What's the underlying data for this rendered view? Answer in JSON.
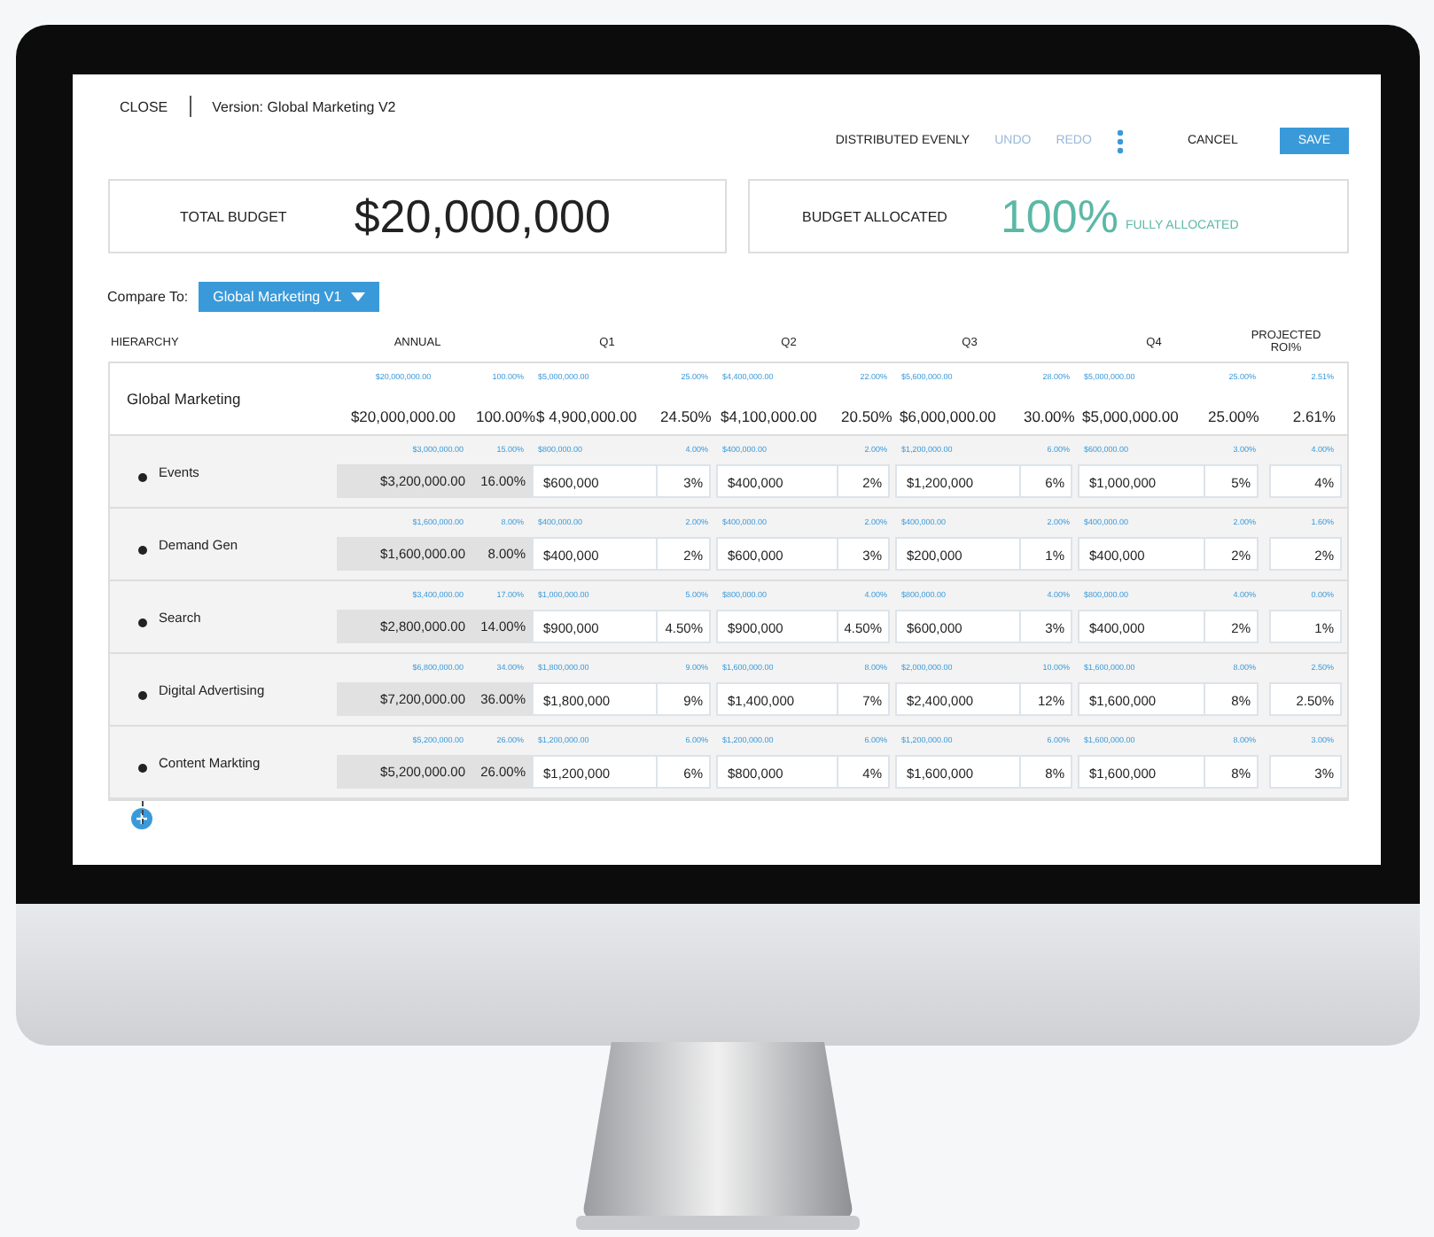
{
  "header": {
    "close": "CLOSE",
    "version": "Version: Global Marketing V2"
  },
  "toolbar": [
    {
      "kind": "link",
      "label": "DISTRIBUTED EVENLY",
      "disabled": false
    },
    {
      "kind": "link",
      "label": "UNDO",
      "disabled": true
    },
    {
      "kind": "link",
      "label": "REDO",
      "disabled": true
    },
    {
      "kind": "more"
    },
    {
      "kind": "link",
      "label": "CANCEL",
      "disabled": false
    },
    {
      "kind": "primary",
      "label": "SAVE",
      "disabled": false
    }
  ],
  "summary": {
    "total_budget": {
      "label": "TOTAL BUDGET",
      "value": "$20,000,000"
    },
    "budget_allocated": {
      "label": "BUDGET ALLOCATED",
      "value": "100%",
      "note": "FULLY ALLOCATED"
    }
  },
  "compare": {
    "label": "Compare To:",
    "dropdown": "Global Marketing V1"
  },
  "table": {
    "columns": [
      "HIERARCHY",
      "ANNUAL",
      "",
      "Q1",
      "",
      "Q2",
      "",
      "Q3",
      "",
      "Q4",
      "",
      "PROJECTED ROI%"
    ],
    "rows": [
      {
        "cells": [
          {
            "value": "Global Marketing"
          },
          {
            "reference": "$20,000,000.00",
            "value": "$20,000,000.00"
          },
          {
            "reference": "100.00%",
            "value": "100.00%"
          },
          {
            "reference": "$5,000,000.00",
            "value": "$ 4,900,000.00"
          },
          {
            "reference": "25.00%",
            "value": "24.50%"
          },
          {
            "reference": "$4,400,000.00",
            "value": "$4,100,000.00"
          },
          {
            "reference": "22.00%",
            "value": "20.50%"
          },
          {
            "reference": "$5,600,000.00",
            "value": "$6,000,000.00"
          },
          {
            "reference": "28.00%",
            "value": "30.00%"
          },
          {
            "reference": "$5,000,000.00",
            "value": "$5,000,000.00"
          },
          {
            "reference": "25.00%",
            "value": "25.00%"
          },
          {
            "reference": "2.51%",
            "value": "2.61%"
          }
        ],
        "children": [
          {
            "cells": [
              {
                "value": "Events"
              },
              {
                "reference": "$3,000,000.00",
                "value": "$3,200,000.00"
              },
              {
                "reference": "15.00%",
                "value": "16.00%"
              },
              {
                "reference": "$800,000.00",
                "value": "$600,000"
              },
              {
                "reference": "4.00%",
                "value": "3%"
              },
              {
                "reference": "$400,000.00",
                "value": "$400,000"
              },
              {
                "reference": "2.00%",
                "value": "2%"
              },
              {
                "reference": "$1,200,000.00",
                "value": "$1,200,000"
              },
              {
                "reference": "6.00%",
                "value": "6%"
              },
              {
                "reference": "$600,000.00",
                "value": "$1,000,000"
              },
              {
                "reference": "3.00%",
                "value": "5%"
              },
              {
                "reference": "4.00%",
                "value": "4%"
              }
            ]
          },
          {
            "cells": [
              {
                "value": "Demand Gen"
              },
              {
                "reference": "$1,600,000.00",
                "value": "$1,600,000.00"
              },
              {
                "reference": "8.00%",
                "value": "8.00%"
              },
              {
                "reference": "$400,000.00",
                "value": "$400,000"
              },
              {
                "reference": "2.00%",
                "value": "2%"
              },
              {
                "reference": "$400,000.00",
                "value": "$600,000"
              },
              {
                "reference": "2.00%",
                "value": "3%"
              },
              {
                "reference": "$400,000.00",
                "value": "$200,000"
              },
              {
                "reference": "2.00%",
                "value": "1%"
              },
              {
                "reference": "$400,000.00",
                "value": "$400,000"
              },
              {
                "reference": "2.00%",
                "value": "2%"
              },
              {
                "reference": "1.60%",
                "value": "2%"
              }
            ]
          },
          {
            "cells": [
              {
                "value": "Search"
              },
              {
                "reference": "$3,400,000.00",
                "value": "$2,800,000.00"
              },
              {
                "reference": "17.00%",
                "value": "14.00%"
              },
              {
                "reference": "$1,000,000.00",
                "value": "$900,000"
              },
              {
                "reference": "5.00%",
                "value": "4.50%"
              },
              {
                "reference": "$800,000.00",
                "value": "$900,000"
              },
              {
                "reference": "4.00%",
                "value": "4.50%"
              },
              {
                "reference": "$800,000.00",
                "value": "$600,000"
              },
              {
                "reference": "4.00%",
                "value": "3%"
              },
              {
                "reference": "$800,000.00",
                "value": "$400,000"
              },
              {
                "reference": "4.00%",
                "value": "2%"
              },
              {
                "reference": "0.00%",
                "value": "1%"
              }
            ]
          },
          {
            "cells": [
              {
                "value": "Digital Advertising"
              },
              {
                "reference": "$6,800,000.00",
                "value": "$7,200,000.00"
              },
              {
                "reference": "34.00%",
                "value": "36.00%"
              },
              {
                "reference": "$1,800,000.00",
                "value": "$1,800,000"
              },
              {
                "reference": "9.00%",
                "value": "9%"
              },
              {
                "reference": "$1,600,000.00",
                "value": "$1,400,000"
              },
              {
                "reference": "8.00%",
                "value": "7%"
              },
              {
                "reference": "$2,000,000.00",
                "value": "$2,400,000"
              },
              {
                "reference": "10.00%",
                "value": "12%"
              },
              {
                "reference": "$1,600,000.00",
                "value": "$1,600,000"
              },
              {
                "reference": "8.00%",
                "value": "8%"
              },
              {
                "reference": "2.50%",
                "value": "2.50%"
              }
            ]
          },
          {
            "cells": [
              {
                "value": "Content Markting"
              },
              {
                "reference": "$5,200,000.00",
                "value": "$5,200,000.00"
              },
              {
                "reference": "26.00%",
                "value": "26.00%"
              },
              {
                "reference": "$1,200,000.00",
                "value": "$1,200,000"
              },
              {
                "reference": "6.00%",
                "value": "6%"
              },
              {
                "reference": "$1,200,000.00",
                "value": "$800,000"
              },
              {
                "reference": "6.00%",
                "value": "4%"
              },
              {
                "reference": "$1,200,000.00",
                "value": "$1,600,000"
              },
              {
                "reference": "6.00%",
                "value": "8%"
              },
              {
                "reference": "$1,600,000.00",
                "value": "$1,600,000"
              },
              {
                "reference": "8.00%",
                "value": "8%"
              },
              {
                "reference": "3.00%",
                "value": "3%"
              }
            ]
          }
        ]
      }
    ]
  }
}
